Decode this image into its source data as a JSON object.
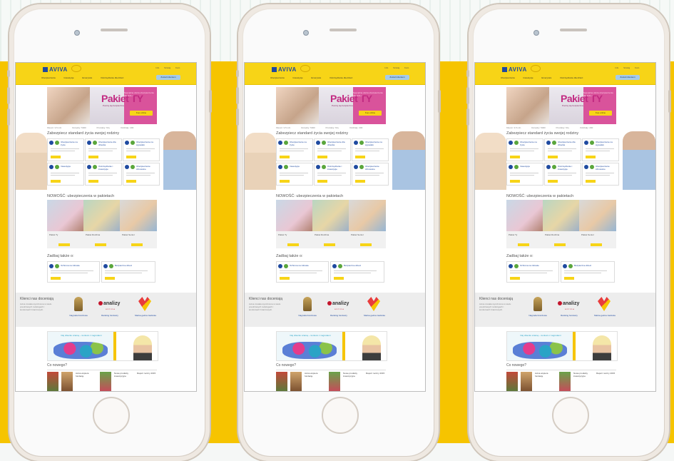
{
  "site": {
    "logo_text": "AVIVA",
    "header_tools": [
      "Info",
      "Szukaj",
      "Kont."
    ],
    "nav_items": [
      "Ubezpieczenia",
      "Inwestycje",
      "Emerytura",
      "Oszczędzanie dla dzieci"
    ],
    "nav_button": "Zostań klientem",
    "banner": {
      "title": "Pakiet TY",
      "subtitle": "Poczuj się bezpieczna",
      "side_text": "Specjalna oferta ubezpieczenia dla kobiet",
      "cta": "Kup online"
    },
    "stats": [
      "Klienci: 3,5 mln",
      "Doradcy: 5000",
      "Produkty: 60+",
      "Oddziały: 200"
    ],
    "section_standard_title": "Zabezpiecz standard życia swojej rodziny",
    "cards": [
      {
        "title": "Ubezpieczenie na życie"
      },
      {
        "title": "Ubezpieczenie dla dziecka"
      },
      {
        "title": "Ubezpieczenie na wypadek"
      },
      {
        "title": "Inwestycje"
      },
      {
        "title": "Oszczędzanie i inwestycje"
      },
      {
        "title": "Ubezpieczenie zdrowotne"
      }
    ],
    "section_new_title": "NOWOŚĆ: ubezpieczenia w pakietach",
    "gallery_captions": [
      "Pakiet Ty",
      "Pakiet Rodzina",
      "Pakiet Senior"
    ],
    "section_see_also_title": "Zadbaj także o:",
    "mini_cards": [
      {
        "title": "Ochrona na zdrowie"
      },
      {
        "title": "Bezpieczne dzieci"
      }
    ],
    "awards": {
      "title": "Klienci nas doceniają",
      "text": "Aviva została wyróżniona w wielu prestiżowych rankingach i konkursach branżowych.",
      "caption_1": "Nagroda branżowa",
      "caption_2": "Ranking funduszy",
      "caption_3": "Marka godna zaufania",
      "analizy_name": "analizy",
      "analizy_sub": "online"
    },
    "promo_text": "Daj dziecku szansę – konkurs z nagrodami",
    "news_title": "Co nowego?",
    "news_items": [
      {
        "text": "Aviva wspiera fundację"
      },
      {
        "text": "Nowe produkty inwestycyjne"
      },
      {
        "text": "Raport roczny 2015"
      }
    ]
  },
  "colors": {
    "brand_yellow": "#f7d417",
    "brand_blue": "#1f4aa0",
    "banner_pink": "#d9539b",
    "background_yellow": "#f6c400"
  }
}
